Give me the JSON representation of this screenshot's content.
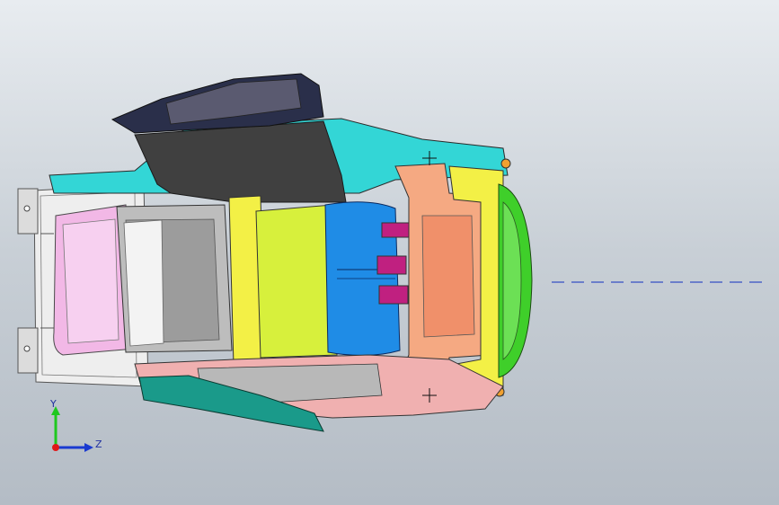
{
  "viewport": {
    "background_top": "#e8ecf0",
    "background_bottom": "#b4bcc5"
  },
  "model": {
    "colors": {
      "pink": "#f2b8e6",
      "gray_bin": "#a9a9a9",
      "lime": "#d7f03c",
      "yellow": "#f3f046",
      "blue": "#1f8ce6",
      "salmon": "#f5a982",
      "green_bumper": "#3fcf2a",
      "cyan": "#33d6d6",
      "dark_gray": "#404040",
      "teal": "#1a9a8a",
      "rose": "#f0b0b0",
      "magenta": "#c02080",
      "frame": "#e8e8e8"
    }
  },
  "centerline": {
    "color": "#1030c0"
  },
  "triad": {
    "y_label": "Y",
    "z_label": "Z",
    "y_color": "#1ec81e",
    "z_color": "#1a3ad0",
    "origin_color": "#e01818"
  }
}
